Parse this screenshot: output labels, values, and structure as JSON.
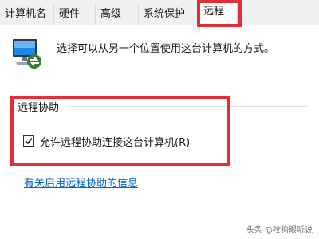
{
  "tabs": [
    {
      "label": "计算机名"
    },
    {
      "label": "硬件"
    },
    {
      "label": "高级"
    },
    {
      "label": "系统保护"
    },
    {
      "label": "远程",
      "selected": true
    }
  ],
  "remote_desktop_description": "选择可以从另一个位置使用这台计算机的方式。",
  "remote_assistance": {
    "group_title": "远程协助",
    "allow_checkbox_label": "允许远程协助连接这台计算机(R)",
    "allow_checked": true,
    "info_link": "有关启用远程协助的信息"
  },
  "watermark": "头条 @咬狗眼听说",
  "colors": {
    "highlight_red": "#e0303a",
    "link_blue": "#0066cc",
    "tab_strip": "#f0f0f0"
  },
  "icons": {
    "computer": "remote-computer-icon",
    "check": "checkmark-icon"
  }
}
